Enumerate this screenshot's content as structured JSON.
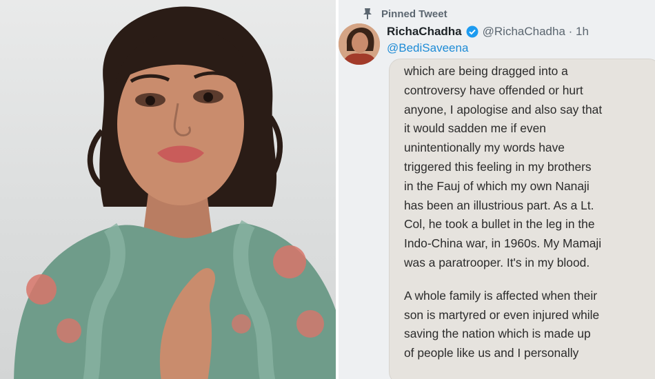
{
  "tweet": {
    "pinned_label": "Pinned Tweet",
    "display_name": "RichaChadha",
    "handle_time": "@RichaChadha · 1h",
    "reply_to": "@BediSaveena",
    "body_lines_1": [
      "which are being dragged into a",
      "controversy have offended or hurt",
      "anyone, I apologise and also say that",
      "it would sadden me if even",
      "unintentionally my words have",
      "triggered this feeling in my brothers",
      "in the Fauj of which my own Nanaji",
      "has been an illustrious part. As a Lt.",
      "Col, he took a bullet in the leg in the",
      "Indo-China war, in 1960s. My Mamaji",
      "was a paratrooper. It's in my blood."
    ],
    "body_lines_2": [
      "A whole family is affected when their",
      "son is martyred or even injured while",
      "saving the nation which is made up",
      "of people like us and I personally"
    ]
  },
  "colors": {
    "verified_badge": "#1d9bf0",
    "reply_link": "#1d8bd6",
    "card_background": "#e6e3de"
  },
  "icons": [
    "pin-icon",
    "verified-badge-icon"
  ]
}
